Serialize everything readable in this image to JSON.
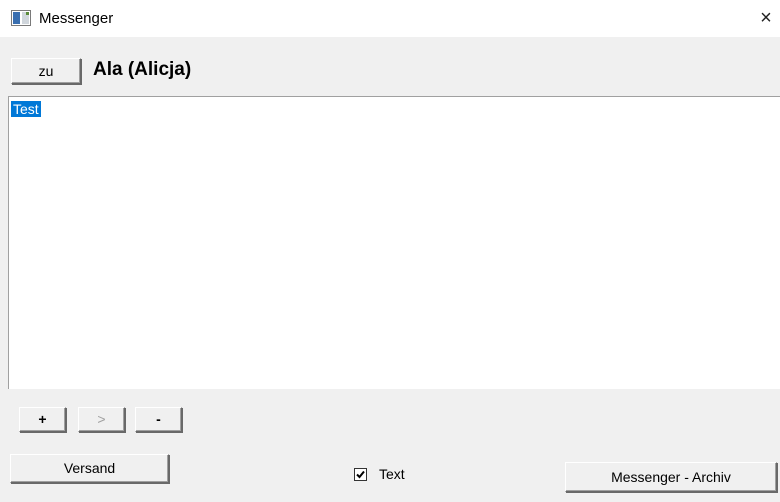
{
  "window": {
    "title": "Messenger",
    "close_icon": "×"
  },
  "header": {
    "zu_label": "zu",
    "contact_name": "Ala (Alicja)"
  },
  "message_area": {
    "text": "Test"
  },
  "toolbar": {
    "plus_label": "+",
    "next_label": ">",
    "minus_label": "-"
  },
  "footer": {
    "versand_label": "Versand",
    "text_checkbox_label": "Text",
    "text_checkbox_checked": true,
    "archiv_label": "Messenger - Archiv"
  },
  "colors": {
    "selection": "#0078d7",
    "window_bg": "#f0f0f0"
  }
}
